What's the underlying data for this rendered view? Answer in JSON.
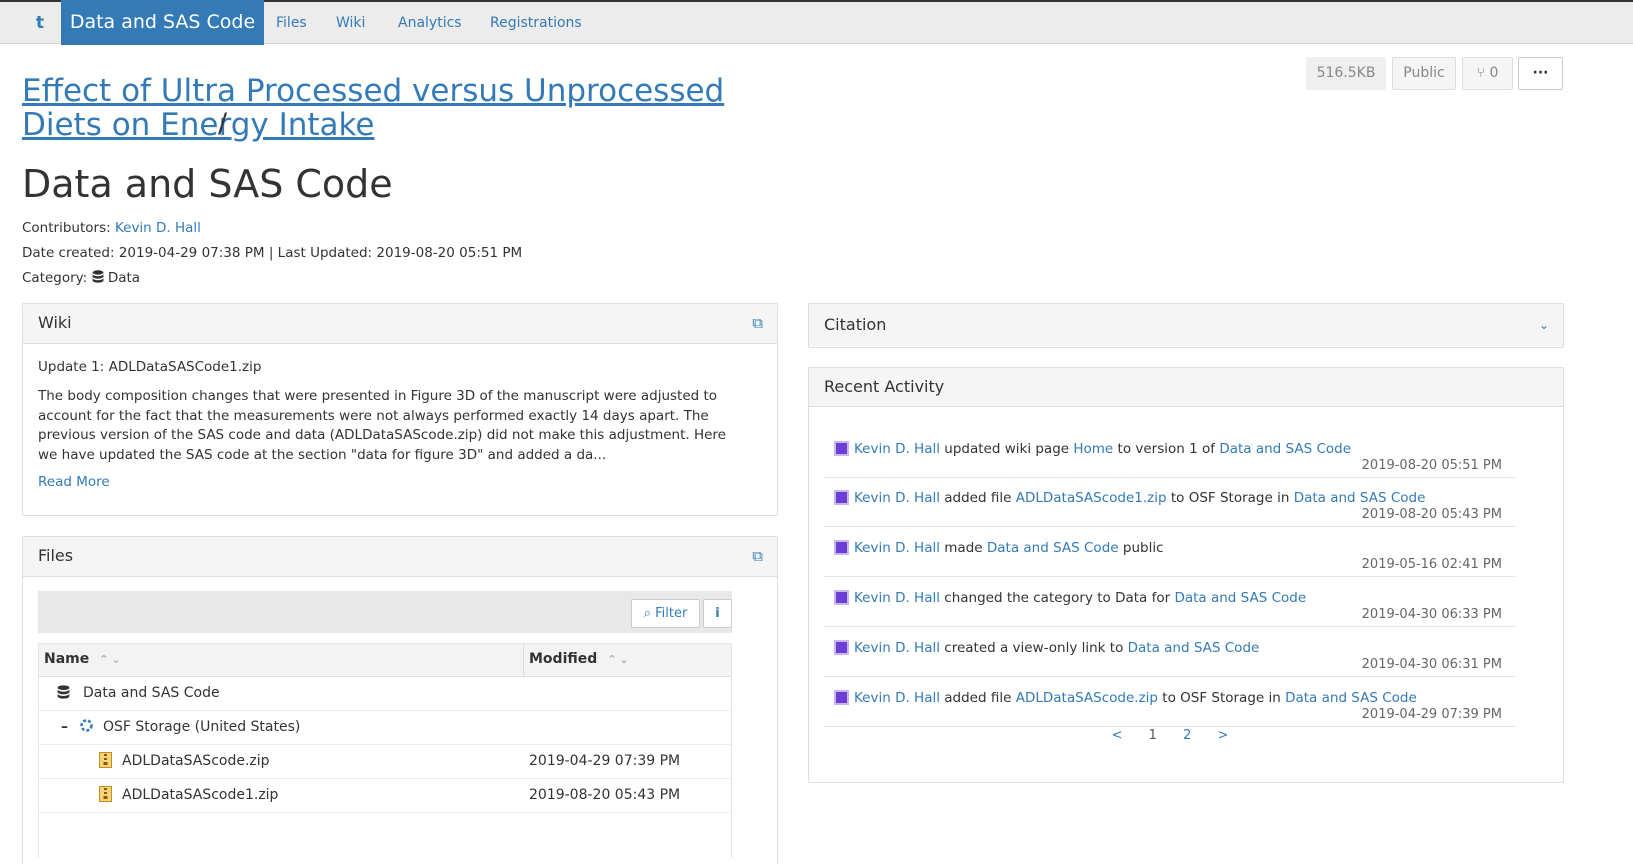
{
  "nav": {
    "home_icon": "t",
    "active": "Data and SAS Code",
    "items": [
      "Files",
      "Wiki",
      "Analytics",
      "Registrations"
    ]
  },
  "header_buttons": {
    "size": "516.5KB",
    "visibility": "Public",
    "forks": "0",
    "more": "···"
  },
  "project": {
    "parent_title": "Effect of Ultra Processed versus Unprocessed Diets on Energy Intake",
    "slash": "/",
    "title": "Data and SAS Code",
    "contributors_label": "Contributors:",
    "contributor": "Kevin D. Hall",
    "dates": "Date created: 2019-04-29 07:38 PM | Last Updated: 2019-08-20 05:51 PM",
    "category_label": "Category:",
    "category": "Data"
  },
  "wiki": {
    "title": "Wiki",
    "subtitle": "Update 1: ADLDataSASCode1.zip",
    "body": "The body composition changes that were presented in Figure 3D of the manuscript were adjusted to account for the fact that the measurements were not always performed exactly 14 days apart. The previous version of the SAS code and data (ADLDataSAScode.zip) did not make this adjustment. Here we have updated the SAS code at the section \"data for figure 3D\" and added a da...",
    "read_more": "Read More"
  },
  "files": {
    "title": "Files",
    "filter_label": "Filter",
    "info_label": "i",
    "col_name": "Name",
    "col_modified": "Modified",
    "rows": [
      {
        "name": "Data and SAS Code",
        "modified": ""
      },
      {
        "name": "OSF Storage (United States)",
        "modified": ""
      },
      {
        "name": "ADLDataSAScode.zip",
        "modified": "2019-04-29 07:39 PM"
      },
      {
        "name": "ADLDataSAScode1.zip",
        "modified": "2019-08-20 05:43 PM"
      }
    ]
  },
  "citation": {
    "title": "Citation"
  },
  "activity": {
    "title": "Recent Activity",
    "items": [
      {
        "user": "Kevin D. Hall",
        "t1": " updated wiki page ",
        "l1": "Home",
        "t2": " to version 1 of ",
        "l2": "Data and SAS Code",
        "t3": "",
        "date": "2019-08-20 05:51 PM"
      },
      {
        "user": "Kevin D. Hall",
        "t1": " added file ",
        "l1": "ADLDataSAScode1.zip",
        "t2": " to OSF Storage in ",
        "l2": "Data and SAS Code",
        "t3": "",
        "date": "2019-08-20 05:43 PM"
      },
      {
        "user": "Kevin D. Hall",
        "t1": " made ",
        "l1": "Data and SAS Code",
        "t2": " public",
        "l2": "",
        "t3": "",
        "date": "2019-05-16 02:41 PM"
      },
      {
        "user": "Kevin D. Hall",
        "t1": " changed the category to Data for ",
        "l1": "Data and SAS Code",
        "t2": "",
        "l2": "",
        "t3": "",
        "date": "2019-04-30 06:33 PM"
      },
      {
        "user": "Kevin D. Hall",
        "t1": " created a view-only link to ",
        "l1": "Data and SAS Code",
        "t2": "",
        "l2": "",
        "t3": "",
        "date": "2019-04-30 06:31 PM"
      },
      {
        "user": "Kevin D. Hall",
        "t1": " added file ",
        "l1": "ADLDataSAScode.zip",
        "t2": " to OSF Storage in ",
        "l2": "Data and SAS Code",
        "t3": "",
        "date": "2019-04-29 07:39 PM"
      }
    ],
    "pager": {
      "prev": "<",
      "p1": "1",
      "p2": "2",
      "next": ">"
    }
  }
}
